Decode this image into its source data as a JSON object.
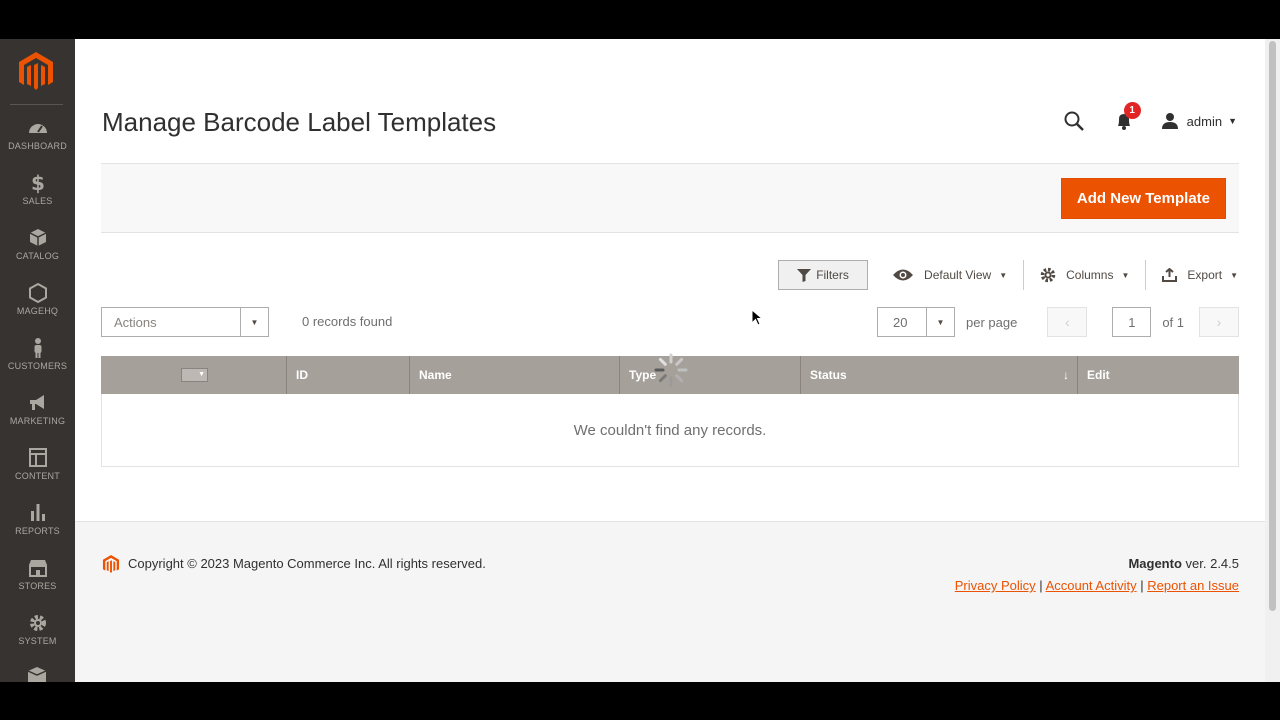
{
  "sidebar": {
    "items": [
      {
        "label": "DASHBOARD",
        "icon": "dashboard-icon"
      },
      {
        "label": "SALES",
        "icon": "dollar-icon"
      },
      {
        "label": "CATALOG",
        "icon": "catalog-box-icon"
      },
      {
        "label": "MAGEHQ",
        "icon": "hexagon-icon"
      },
      {
        "label": "CUSTOMERS",
        "icon": "customer-person-icon"
      },
      {
        "label": "MARKETING",
        "icon": "megaphone-icon"
      },
      {
        "label": "CONTENT",
        "icon": "content-layout-icon"
      },
      {
        "label": "REPORTS",
        "icon": "bar-chart-icon"
      },
      {
        "label": "STORES",
        "icon": "store-icon"
      },
      {
        "label": "SYSTEM",
        "icon": "gear-icon"
      }
    ]
  },
  "header": {
    "title": "Manage Barcode Label Templates",
    "notifications_count": "1",
    "user": "admin"
  },
  "action_bar": {
    "add_button": "Add New Template"
  },
  "toolbar": {
    "filters": "Filters",
    "view": "Default View",
    "columns": "Columns",
    "export": "Export"
  },
  "mass_actions": {
    "placeholder": "Actions",
    "records_found": "0 records found"
  },
  "pager": {
    "per_page_value": "20",
    "per_page_label": "per page",
    "current_page": "1",
    "of_label": "of 1"
  },
  "grid": {
    "columns": [
      "ID",
      "Name",
      "Type",
      "Status",
      "Edit"
    ],
    "sort_indicator": "↓",
    "empty_message": "We couldn't find any records."
  },
  "footer": {
    "copyright": "Copyright © 2023 Magento Commerce Inc. All rights reserved.",
    "brand": "Magento",
    "version": " ver. 2.4.5",
    "links": [
      "Privacy Policy",
      "Account Activity",
      "Report an Issue"
    ]
  },
  "colors": {
    "accent": "#eb5202",
    "sidebar": "#373330",
    "grid_header": "#a6a09b"
  }
}
